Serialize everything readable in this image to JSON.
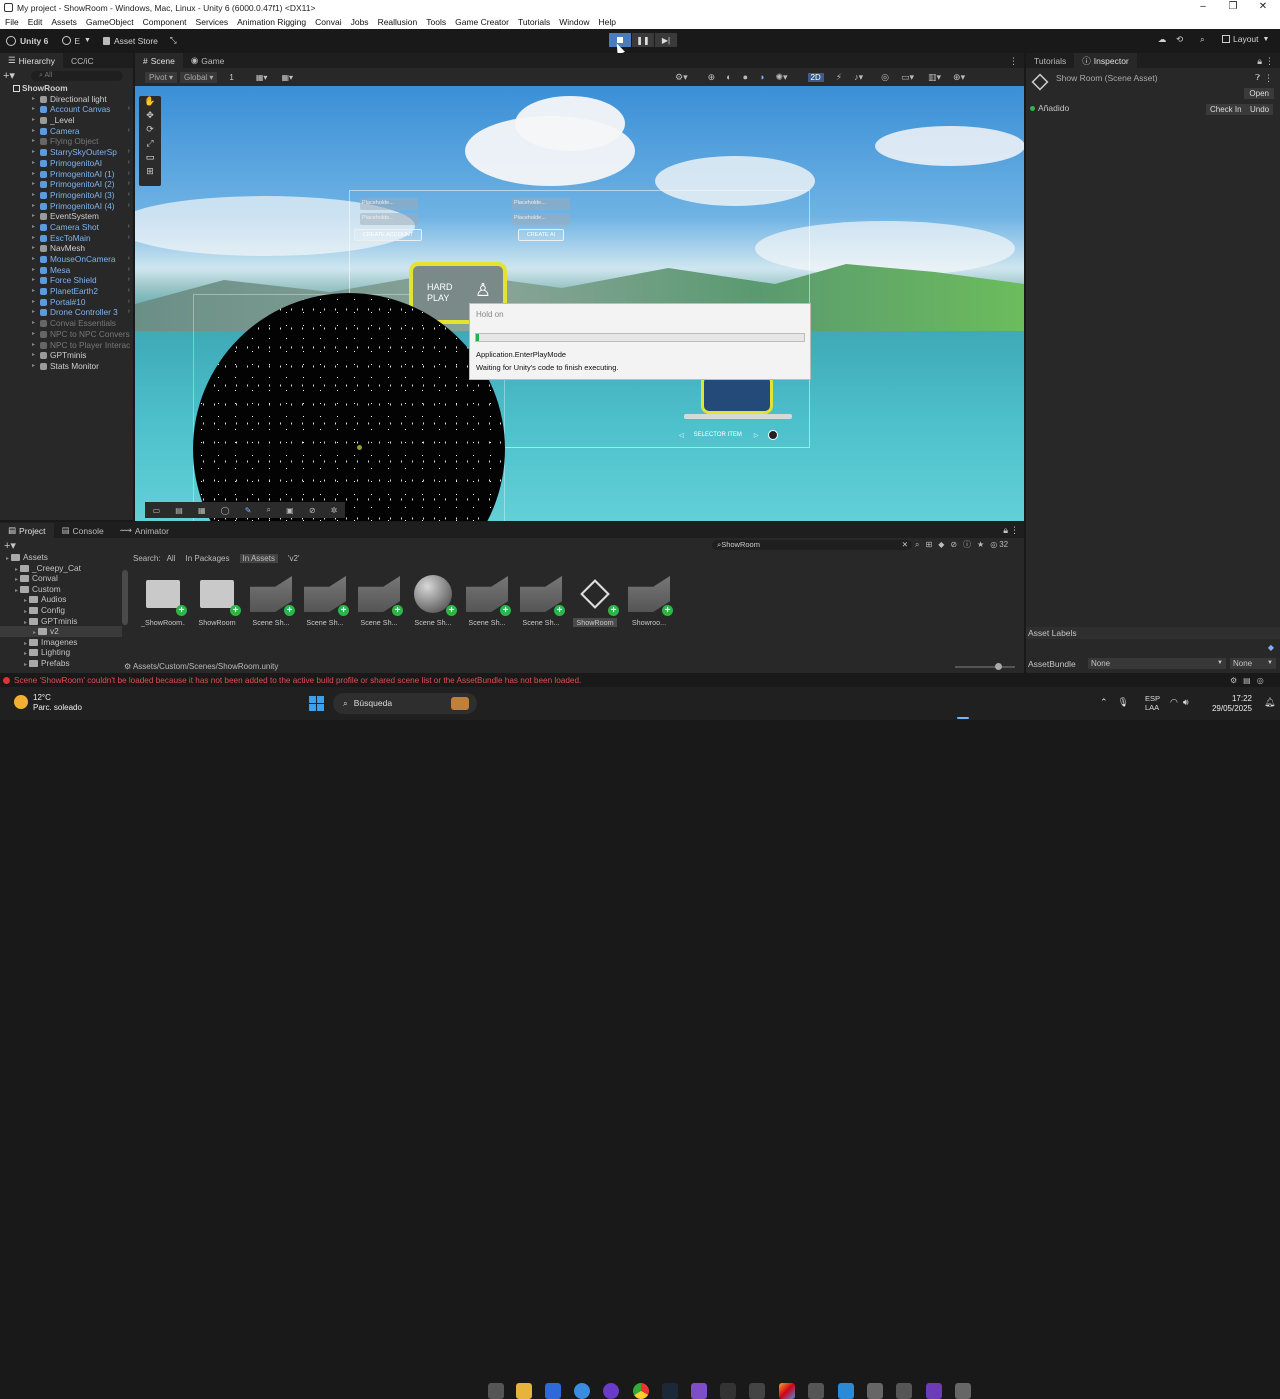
{
  "window": {
    "title": "My project - ShowRoom - Windows, Mac, Linux - Unity 6 (6000.0.47f1) <DX11>"
  },
  "menu": [
    "File",
    "Edit",
    "Assets",
    "GameObject",
    "Component",
    "Services",
    "Animation Rigging",
    "Convai",
    "Jobs",
    "Reallusion",
    "Tools",
    "Game Creator",
    "Tutorials",
    "Window",
    "Help"
  ],
  "toolbar": {
    "unity_label": "Unity 6",
    "account": "E",
    "asset_store": "Asset Store",
    "layout": "Layout"
  },
  "hierarchy": {
    "tab": "Hierarchy",
    "tab2": "CC/iC",
    "search_placeholder": "All",
    "root": "ShowRoom",
    "items": [
      {
        "label": "Directional light",
        "style": "normal"
      },
      {
        "label": "Account Canvas",
        "style": "blue"
      },
      {
        "label": "_Level",
        "style": "normal"
      },
      {
        "label": "Camera",
        "style": "blue"
      },
      {
        "label": "Flying Object",
        "style": "grey"
      },
      {
        "label": "StarrySkyOuterSp",
        "style": "blue"
      },
      {
        "label": "PrimogenitoAI",
        "style": "blue"
      },
      {
        "label": "PrimogenitoAI (1)",
        "style": "blue"
      },
      {
        "label": "PrimogenitoAI (2)",
        "style": "blue"
      },
      {
        "label": "PrimogenitoAI (3)",
        "style": "blue"
      },
      {
        "label": "PrimogenitoAI (4)",
        "style": "blue"
      },
      {
        "label": "EventSystem",
        "style": "normal"
      },
      {
        "label": "Camera Shot",
        "style": "blue"
      },
      {
        "label": "EscToMain",
        "style": "blue"
      },
      {
        "label": "NavMesh",
        "style": "normal"
      },
      {
        "label": "MouseOnCamera",
        "style": "blue"
      },
      {
        "label": "Mesa",
        "style": "blue"
      },
      {
        "label": "Force Shield",
        "style": "blue"
      },
      {
        "label": "PlanetEarth2",
        "style": "blue"
      },
      {
        "label": "Portal#10",
        "style": "blue"
      },
      {
        "label": "Drone Controller 3",
        "style": "blue"
      },
      {
        "label": "Convai Essentials",
        "style": "grey"
      },
      {
        "label": "NPC to NPC Convers",
        "style": "grey"
      },
      {
        "label": "NPC to Player Interac",
        "style": "grey"
      },
      {
        "label": "GPTminis",
        "style": "normal"
      },
      {
        "label": "Stats Monitor",
        "style": "normal"
      }
    ]
  },
  "scene": {
    "tab_scene": "Scene",
    "tab_game": "Game",
    "pivot": "Pivot",
    "global": "Global",
    "grid_val": "1",
    "mode_2d": "2D",
    "ui_create_account": "CREATE ACCOUNT",
    "ui_create_ai": "CREATE AI",
    "ui_hard": "HARD",
    "ui_play": "PLAY",
    "ui_selector": "SELECTOR ITEM",
    "ui_placeholder": "Placeholde..."
  },
  "dialog": {
    "title": "Hold on",
    "line1": "Application.EnterPlayMode",
    "line2": "Waiting for Unity's code to finish executing.",
    "progress": 0.01
  },
  "inspector": {
    "tab_tutorials": "Tutorials",
    "tab_inspector": "Inspector",
    "object": "Show Room (Scene Asset)",
    "open": "Open",
    "status": "Añadido",
    "check_in": "Check In",
    "undo": "Undo",
    "asset_labels": "Asset Labels",
    "asset_bundle": "AssetBundle",
    "bundle_value": "None",
    "bundle_variant": "None"
  },
  "project": {
    "tab_project": "Project",
    "tab_console": "Console",
    "tab_animator": "Animator",
    "search_value": "ShowRoom",
    "count": "32",
    "filter_label": "Search:",
    "filters": [
      "All",
      "In Packages",
      "In Assets",
      "'v2'"
    ],
    "tree": [
      {
        "label": "Assets",
        "indent": 0
      },
      {
        "label": "_Creepy_Cat",
        "indent": 1
      },
      {
        "label": "Conval",
        "indent": 1
      },
      {
        "label": "Custom",
        "indent": 1
      },
      {
        "label": "Audios",
        "indent": 2
      },
      {
        "label": "Config",
        "indent": 2
      },
      {
        "label": "GPTminis",
        "indent": 2
      },
      {
        "label": "v2",
        "indent": 3
      },
      {
        "label": "Imagenes",
        "indent": 2
      },
      {
        "label": "Lighting",
        "indent": 2
      },
      {
        "label": "Prefabs",
        "indent": 2
      }
    ],
    "assets": [
      {
        "label": "_ShowRoom...",
        "kind": "folder"
      },
      {
        "label": "ShowRoom",
        "kind": "folder"
      },
      {
        "label": "Scene Sh...",
        "kind": "mesh"
      },
      {
        "label": "Scene Sh...",
        "kind": "mesh"
      },
      {
        "label": "Scene Sh...",
        "kind": "mesh"
      },
      {
        "label": "Scene Sh...",
        "kind": "sphere"
      },
      {
        "label": "Scene Sh...",
        "kind": "mesh"
      },
      {
        "label": "Scene Sh...",
        "kind": "mesh"
      },
      {
        "label": "ShowRoom",
        "kind": "unity"
      },
      {
        "label": "Showroo...",
        "kind": "mesh"
      }
    ],
    "path": "Assets/Custom/Scenes/ShowRoom.unity"
  },
  "status": {
    "error": "Scene 'ShowRoom' couldn't be loaded because it has not been added to the active build profile or shared scene list or the AssetBundle has not been loaded."
  },
  "taskbar": {
    "temp": "12°C",
    "weather": "Parc. soleado",
    "search": "Búsqueda",
    "lang1": "ESP",
    "lang2": "LAA",
    "time": "17:22",
    "date": "29/05/2025"
  }
}
